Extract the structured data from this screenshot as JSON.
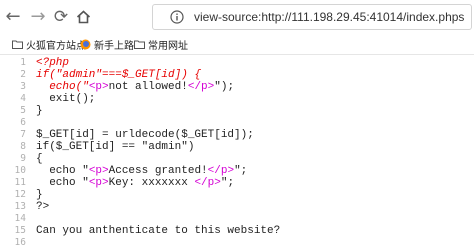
{
  "browser": {
    "url": "view-source:http://111.198.29.45:41014/index.phps",
    "bookmarks": [
      {
        "label": "火狐官方站点"
      },
      {
        "label": "新手上路"
      },
      {
        "label": "常用网址"
      }
    ]
  },
  "source": {
    "line_numbers": [
      "1",
      "2",
      "3",
      "4",
      "5",
      "6",
      "7",
      "8",
      "9",
      "10",
      "11",
      "12",
      "13",
      "14",
      "15",
      "16"
    ],
    "l1": "<?php",
    "l2": "if(\"admin\"===$_GET[id]) {",
    "l3_a": "  echo(\"",
    "l3_tag_open": "<p>",
    "l3_b": "not allowed!",
    "l3_tag_close": "</p>",
    "l3_c": "\");",
    "l4": "  exit();",
    "l5": "}",
    "l6": "",
    "l7": "$_GET[id] = urldecode($_GET[id]);",
    "l8": "if($_GET[id] == \"admin\")",
    "l9": "{",
    "l10_a": "  echo \"",
    "l10_tag_open": "<p>",
    "l10_b": "Access granted!",
    "l10_tag_close": "</p>",
    "l10_c": "\";",
    "l11_a": "  echo \"",
    "l11_tag_open": "<p>",
    "l11_b": "Key: xxxxxxx ",
    "l11_tag_close": "</p>",
    "l11_c": "\";",
    "l12": "}",
    "l13": "?>",
    "l14": "",
    "l15": "Can you anthenticate to this website?",
    "l16": ""
  }
}
